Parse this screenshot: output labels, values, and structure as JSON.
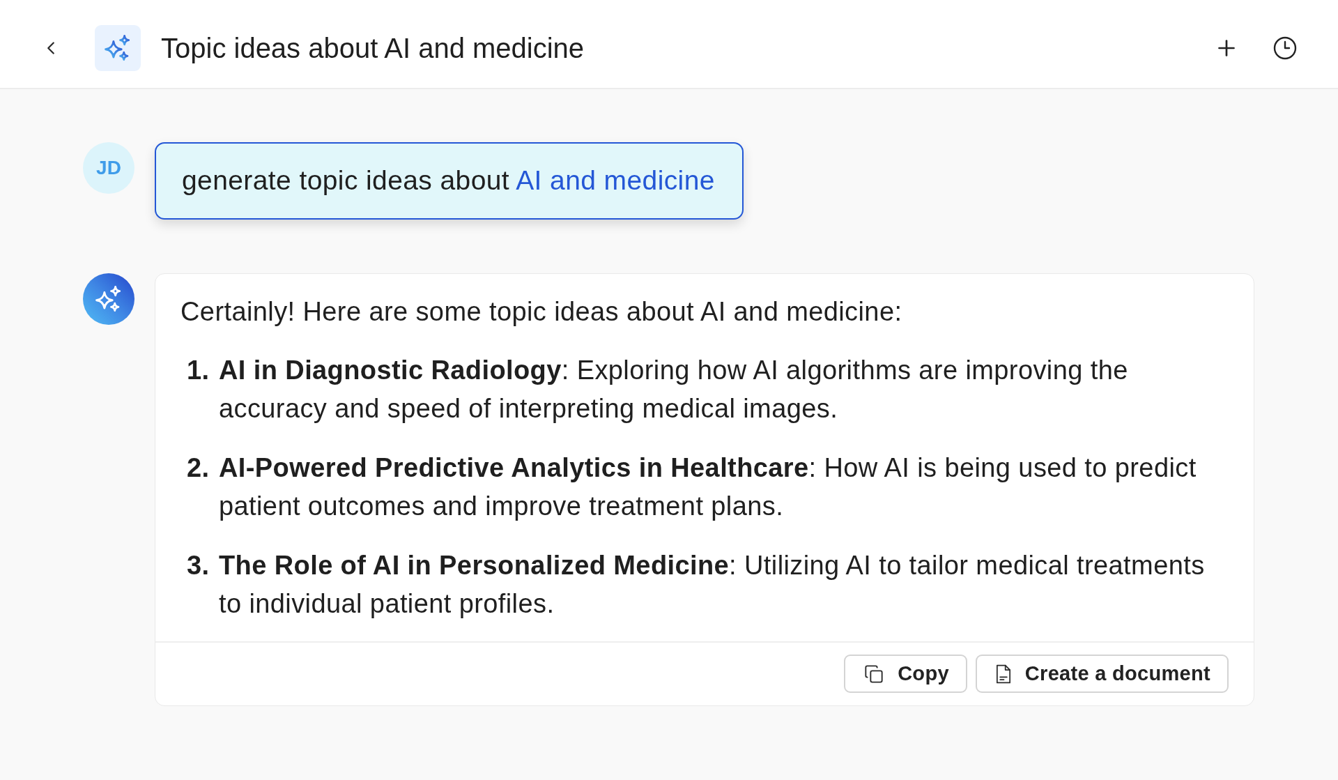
{
  "header": {
    "title": "Topic ideas about AI and medicine"
  },
  "messages": [
    {
      "kind": "user",
      "avatar": "JD",
      "parts": [
        {
          "text": "generate topic ideas about ",
          "highlighted": false
        },
        {
          "text": "AI and medicine",
          "highlighted": true
        }
      ]
    },
    {
      "kind": "assistant",
      "intro": "Certainly! Here are some topic ideas about AI and medicine:",
      "items": [
        {
          "number": "1.",
          "text": "**AI in Diagnostic Radiology**: Exploring how AI algorithms are improving the accuracy and speed of interpreting medical images."
        },
        {
          "number": "2.",
          "text": "**AI-Powered Predictive Analytics in Healthcare**: How AI is being used to predict patient outcomes and improve treatment plans."
        },
        {
          "number": "3.",
          "text": "**The Role of AI in Personalized Medicine**: Utilizing AI to tailor medical treatments to individual patient profiles."
        }
      ],
      "actions": [
        {
          "kind": "copy",
          "label": "Copy"
        },
        {
          "kind": "document",
          "label": "Create a document"
        }
      ]
    }
  ]
}
